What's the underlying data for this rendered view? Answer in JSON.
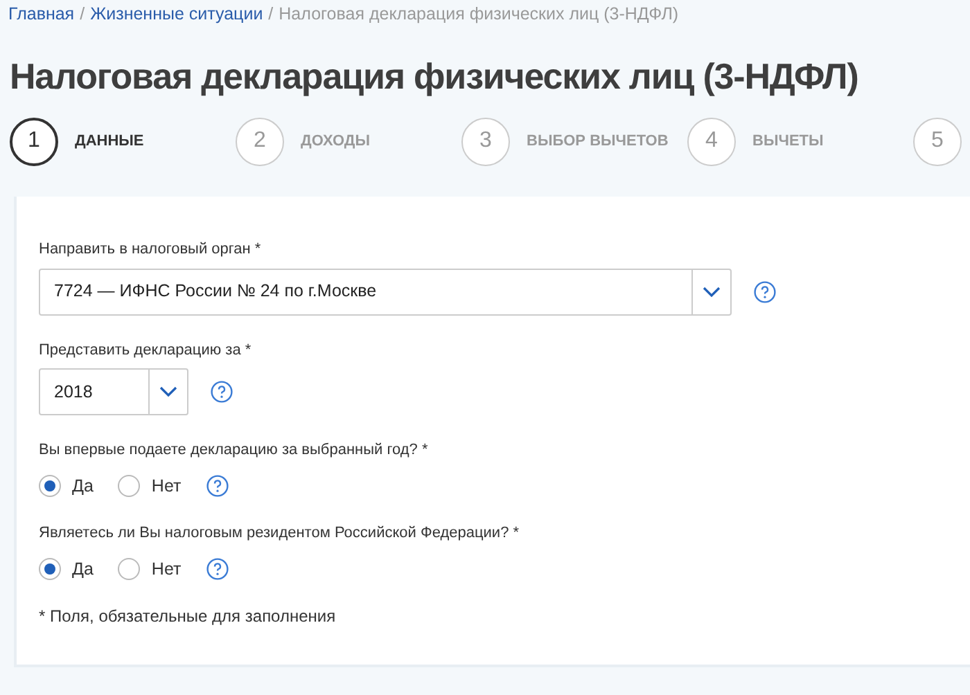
{
  "breadcrumb": [
    {
      "label": "Главная",
      "link": true
    },
    {
      "label": "Жизненные ситуации",
      "link": true
    },
    {
      "label": "Налоговая декларация физических лиц (3-НДФЛ)",
      "link": false
    }
  ],
  "separator": "/",
  "title": "Налоговая декларация физических лиц (3-НДФЛ)",
  "steps": [
    {
      "number": "1",
      "label": "ДАННЫЕ",
      "selected": true
    },
    {
      "number": "2",
      "label": "ДОХОДЫ",
      "selected": false
    },
    {
      "number": "3",
      "label": "ВЫБОР ВЫЧЕТОВ",
      "selected": false
    },
    {
      "number": "4",
      "label": "ВЫЧЕТЫ",
      "selected": false
    },
    {
      "number": "5",
      "selected": false
    }
  ],
  "fields": [
    {
      "kind": "select",
      "label": "Направить в налоговый орган *",
      "value": "7724 — ИФНС России № 24 по г.Москве"
    },
    {
      "kind": "short-select",
      "label": "Представить декларацию за *",
      "value": "2018"
    },
    {
      "kind": "radio",
      "label": "Вы впервые подаете декларацию за выбранный год? *",
      "options": [
        {
          "label": "Да",
          "selected": true
        },
        {
          "label": "Нет",
          "selected": false
        }
      ]
    },
    {
      "kind": "radio",
      "label": "Являетесь ли Вы налоговым резидентом Российской Федерации? *",
      "options": [
        {
          "label": "Да",
          "selected": true
        },
        {
          "label": "Нет",
          "selected": false
        }
      ]
    }
  ],
  "note": "* Поля, обязательные для заполнения"
}
